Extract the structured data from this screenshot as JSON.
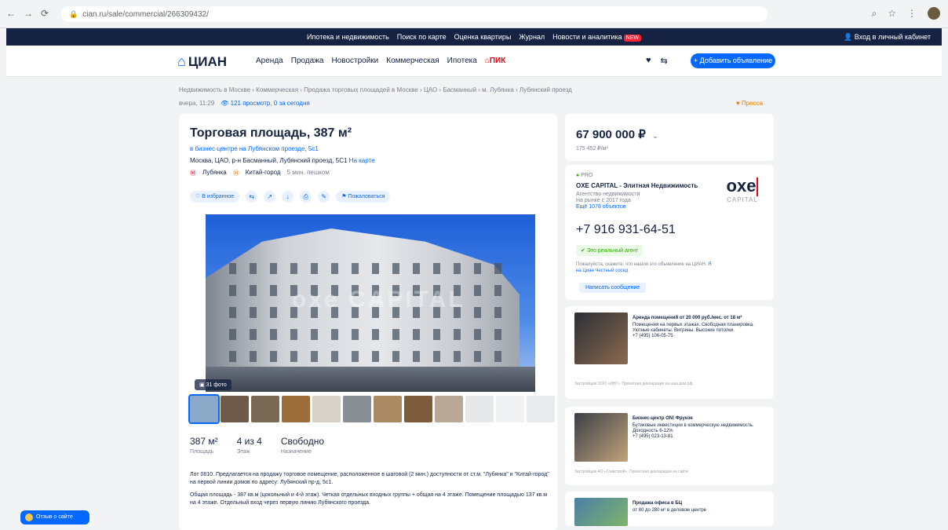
{
  "browser": {
    "url": "cian.ru/sale/commercial/266309432/",
    "nav_icons": [
      "back-icon",
      "forward-icon",
      "reload-icon"
    ]
  },
  "topbar": {
    "items": [
      "Ипотека и недвижимость",
      "Поиск по карте",
      "Оценка квартиры",
      "Журнал",
      "Новости и аналитика"
    ],
    "new_badge": "NEW",
    "login": "Вход в личный кабинет"
  },
  "header": {
    "logo": "ЦИАН",
    "nav": [
      "Аренда",
      "Продажа",
      "Новостройки",
      "Коммерческая",
      "Ипотека"
    ],
    "pik": "ПИК",
    "add_button": "+ Добавить объявление"
  },
  "breadcrumbs": "Недвижимость в Москве › Коммерческая › Продажа торговых площадей в Москве › ЦАО › Басманный › м. Лубянка › Лубянский проезд",
  "sub": {
    "updated": "вчера, 11:29",
    "views": "👁 121 просмотр, 0 за сегодня",
    "favorite": "♥ Пресса"
  },
  "listing": {
    "title": "Торговая площадь, 387 м²",
    "business_center": "в бизнес-центре на Лубянском проезде, 5с1",
    "address": "Москва, ЦАО, р-н Басманный, Лубянский проезд, 5С1",
    "map_link": "На карте",
    "metro": [
      {
        "station": "Лубянка",
        "color": "#e4002b"
      },
      {
        "station": "Китай-город",
        "color": "#f07e00"
      }
    ],
    "walk": "5 мин. пешком",
    "actions": {
      "favorite": "♡ В избранное",
      "problem": "⚑ Пожаловаться"
    },
    "photo_count": "▣ 31 фото",
    "photo_watermark": "oxe CAPITAL",
    "thumb_colors": [
      "#8aa9c8",
      "#6e5a48",
      "#7a6a55",
      "#9b6b3a",
      "#d7d2c7",
      "#8a8f96",
      "#a98a63",
      "#7d5b3d",
      "#b8a895",
      "#e6e7e9",
      "#f0f1f2",
      "#e9eaec"
    ],
    "stats": [
      {
        "value": "387 м²",
        "label": "Площадь"
      },
      {
        "value": "4 из 4",
        "label": "Этаж"
      },
      {
        "value": "Свободно",
        "label": "Назначение"
      }
    ],
    "description": [
      "Лот 0810. Предлагается на продажу торговое помещение, расположенное в шаговой (2 мин.) доступности от ст.м. \"Лубянка\" и \"Китай-город\" на первой линии домов по адресу: Лубянский пр-д, 5с1.",
      "Общая площадь - 387 кв.м (цокольный и 4-й этаж). Четкая отдельных входных группы + общая на 4 этаже. Помещение площадью 137 кв.м на 4 этаже. Отдельный вход через первую линию Лубянского проезда."
    ]
  },
  "price": {
    "value": "67 900 000 ₽",
    "per_meter": "175 452 ₽/м²"
  },
  "agent": {
    "pro": "PRO",
    "name": "OXE CAPITAL - Элитная Недвижимость",
    "type": "Агентство недвижимости",
    "since": "На рынке с 2017 года",
    "objects": "Ещё 1078 объектов",
    "logo_text": "oxe",
    "logo_caption": "CAPITAL",
    "phone": "+7 916 931-64-51",
    "verified": "✔ Это реальный агент",
    "note": "Пожалуйста, скажите, что нашли это объявление на ЦИАН.",
    "note_link": "Я на Циан Честный сосед",
    "message_button": "Написать сообщение"
  },
  "ads": [
    {
      "title": "Аренда помещений от 20 000 руб./мес. от 18 м²",
      "body": "Помещения на первых этажах. Свободная планировка. Уютные кабинеты. Витрины. Высокие потолки.",
      "phone": "+7 (495) 106-05-75",
      "footer": "Застройщик ООО «ИНГ». Проектная декларация на наш.дом.рф",
      "colors": [
        "#2b2f36",
        "#8c6a4f"
      ]
    },
    {
      "title": "Бизнес-центр ON! Фрунзе",
      "body": "Бутиковые инвестиции в коммерческую недвижимость. Доходность 6-12%",
      "phone": "+7 (495) 023-13-81",
      "footer": "Застройщик АО «Главстрой». Проектная декларация на сайте",
      "colors": [
        "#3a3f47",
        "#c3a37c"
      ]
    },
    {
      "title": "Продажа офиса в БЦ",
      "body": "от 80 до 280 м² в деловом центре",
      "phone": "",
      "footer": "",
      "colors": [
        "#4a7fa8",
        "#7fb36a"
      ]
    }
  ],
  "feedback": "Отзыв о сайте"
}
